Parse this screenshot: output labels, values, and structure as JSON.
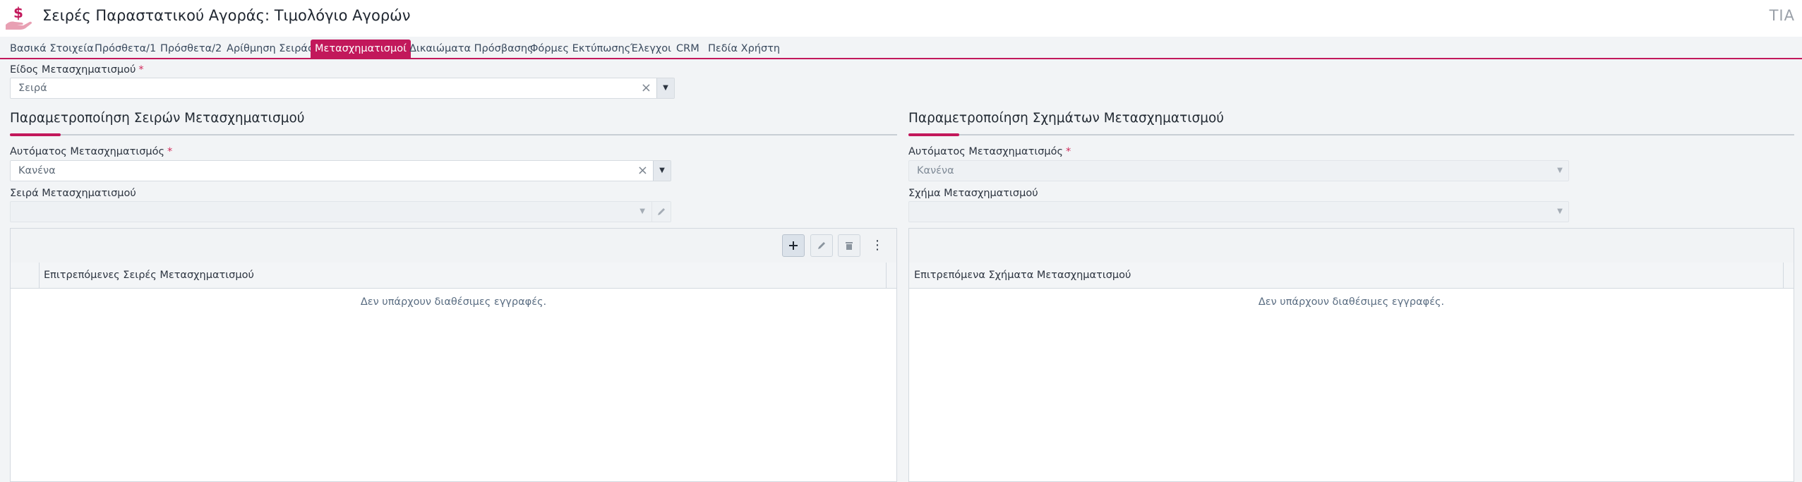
{
  "header": {
    "title": "Σειρές Παραστατικού Αγοράς: Τιμολόγιο Αγορών",
    "user_code": "ΤΙΑ",
    "app_icon": "hand-money-icon"
  },
  "tabs": [
    {
      "label": "Βασικά Στοιχεία",
      "active": false
    },
    {
      "label": "Πρόσθετα/1",
      "active": false
    },
    {
      "label": "Πρόσθετα/2",
      "active": false
    },
    {
      "label": "Αρίθμηση Σειράς",
      "active": false
    },
    {
      "label": "Μετασχηματισμοί",
      "active": true
    },
    {
      "label": "Δικαιώματα Πρόσβασης",
      "active": false
    },
    {
      "label": "Φόρμες Εκτύπωσης",
      "active": false
    },
    {
      "label": "Έλεγχοι",
      "active": false
    },
    {
      "label": "CRM",
      "active": false
    },
    {
      "label": "Πεδία Χρήστη",
      "active": false
    }
  ],
  "transform_type": {
    "label": "Είδος Μετασχηματισμού",
    "required_mark": "*",
    "value": "Σειρά"
  },
  "series_section": {
    "title": "Παραμετροποίηση Σειρών Μετασχηματισμού",
    "auto_label": "Αυτόματος Μετασχηματισμός",
    "auto_required": "*",
    "auto_value": "Κανένα",
    "series_label": "Σειρά Μετασχηματισμού",
    "series_value": "",
    "grid_column": "Επιτρεπόμενες Σειρές Μετασχηματισμού",
    "empty_message": "Δεν υπάρχουν διαθέσιμες εγγραφές."
  },
  "schema_section": {
    "title": "Παραμετροποίηση Σχημάτων Μετασχηματισμού",
    "auto_label": "Αυτόματος Μετασχηματισμός",
    "auto_required": "*",
    "auto_value": "Κανένα",
    "schema_label": "Σχήμα Μετασχηματισμού",
    "schema_value": "",
    "grid_column": "Επιτρεπόμενα Σχήματα Μετασχηματισμού",
    "empty_message": "Δεν υπάρχουν διαθέσιμες εγγραφές."
  },
  "colors": {
    "accent": "#c2185b",
    "background": "#f2f4f6"
  }
}
